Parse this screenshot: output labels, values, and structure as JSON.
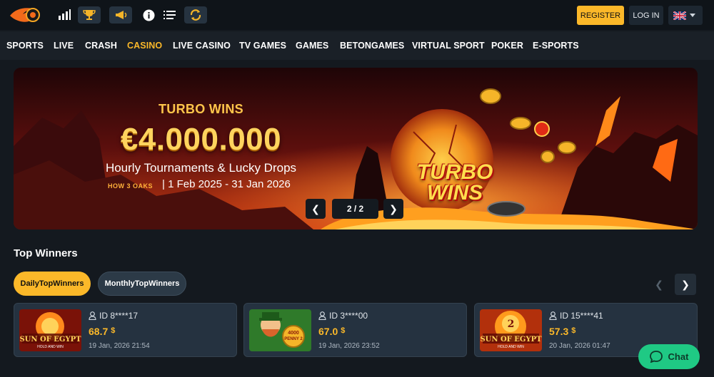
{
  "header": {
    "logo": "sun-of-egypt-flame-logo",
    "icons": [
      "stats-icon",
      "trophy-icon",
      "megaphone-icon",
      "info-icon",
      "list-icon",
      "refresh-icon"
    ],
    "register_label": "REGISTER",
    "login_label": "LOG IN",
    "language_flag": "uk-flag"
  },
  "nav": {
    "items": [
      {
        "label": "SPORTS"
      },
      {
        "label": "LIVE"
      },
      {
        "label": "CRASH"
      },
      {
        "label": "CASINO"
      },
      {
        "label": "LIVE CASINO"
      },
      {
        "label": "TV GAMES"
      },
      {
        "label": "GAMES"
      },
      {
        "label": "BETONGAMES"
      },
      {
        "label": "VIRTUAL SPORT"
      },
      {
        "label": "POKER"
      },
      {
        "label": "E-SPORTS"
      }
    ],
    "active": "CASINO"
  },
  "banner": {
    "title": "TURBO WINS",
    "amount": "€4.000.000",
    "subtitle": "Hourly Tournaments & Lucky Drops",
    "provider": "3 OAKS",
    "dates": "| 1 Feb 2025 - 31 Jan 2026",
    "game_logo": "TURBO WINS",
    "pager": "2 / 2"
  },
  "top_winners": {
    "title": "Top Winners",
    "tabs": [
      {
        "label": "DailyTopWinners"
      },
      {
        "label": "MonthlyTopWinners"
      }
    ],
    "cards": [
      {
        "game": "SUN OF EGYPT HOLD AND WIN",
        "id": "ID 8****17",
        "amount": "68.7",
        "currency": "$",
        "date": "19 Jan, 2026 21:54"
      },
      {
        "game": "4000 GOLDEN PENNY 2",
        "id": "ID 3****00",
        "amount": "67.0",
        "currency": "$",
        "date": "19 Jan, 2026 23:52"
      },
      {
        "game": "SUN OF EGYPT 2 HOLD AND WIN",
        "id": "ID 15****41",
        "amount": "57.3",
        "currency": "$",
        "date": "20 Jan, 2026 01:47"
      }
    ]
  },
  "chat": {
    "label": "Chat"
  },
  "colors": {
    "accent": "#fbb829",
    "background": "#14191f",
    "chat": "#1fc984"
  }
}
